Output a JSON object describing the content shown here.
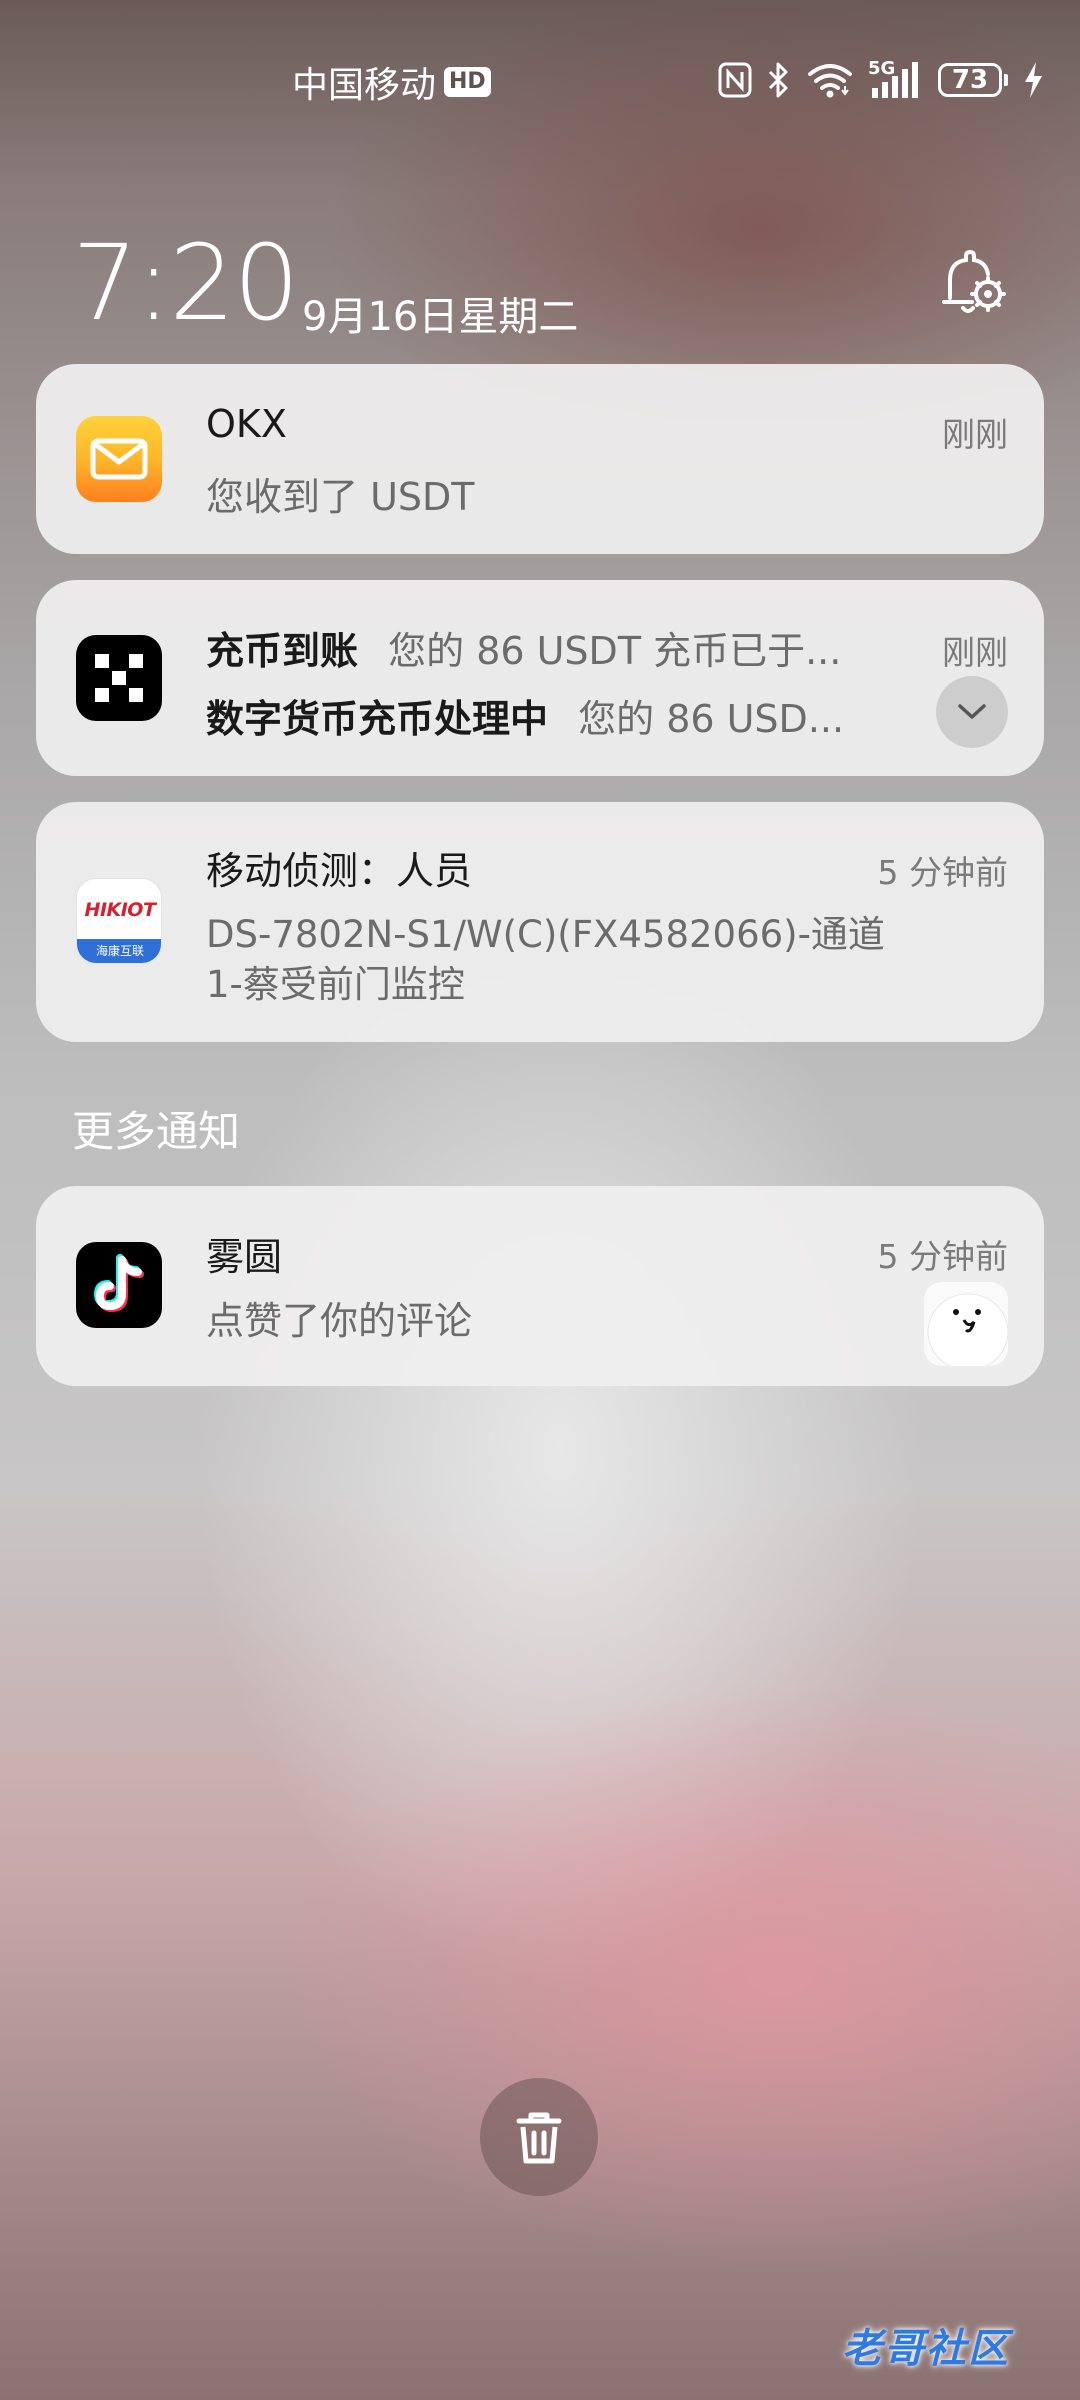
{
  "status_bar": {
    "carrier": "中国移动",
    "hd_badge": "HD",
    "network_type": "5G",
    "battery_percent": "73",
    "icons": [
      "nfc-icon",
      "bluetooth-icon",
      "wifi-icon",
      "cellular-signal-icon",
      "battery-icon",
      "charging-icon"
    ]
  },
  "lockscreen": {
    "time": "7:20",
    "date": "9月16日星期二",
    "notification_settings_icon": "bell-gear-icon"
  },
  "notifications": [
    {
      "app_icon": "mail-icon",
      "title": "OKX",
      "body": "您收到了 USDT",
      "time": "刚刚"
    },
    {
      "app_icon": "okx-icon",
      "line1_title": "充币到账",
      "line1_body": "您的 86 USDT 充币已于...",
      "line2_title": "数字货币充币处理中",
      "line2_body": "您的 86 USD...",
      "time": "刚刚",
      "expand_icon": "chevron-down-icon"
    },
    {
      "app_icon": "hikiot-icon",
      "app_icon_text": "HIKIOT",
      "app_icon_subtext": "海康互联",
      "title": "移动侦测：人员",
      "body_line1": "DS-7802N-S1/W(C)(FX4582066)-通道",
      "body_line2": "1-蔡受前门监控",
      "time": "5 分钟前"
    }
  ],
  "more_section": {
    "title": "更多通知",
    "items": [
      {
        "app_icon": "tiktok-icon",
        "title": "雾圆",
        "body": "点赞了你的评论",
        "time": "5 分钟前",
        "thumbnail": "avatar-thumbnail"
      }
    ]
  },
  "actions": {
    "clear_all_icon": "trash-icon"
  },
  "watermark": "老哥社区",
  "colors": {
    "okx_mail_icon_start": "#ffd23a",
    "okx_mail_icon_end": "#ff8a1e",
    "hikiot_red": "#d6202e",
    "hikiot_blue": "#2f6fd6",
    "card_bg": "#f0efef",
    "watermark_blue": "#2c7be5"
  }
}
